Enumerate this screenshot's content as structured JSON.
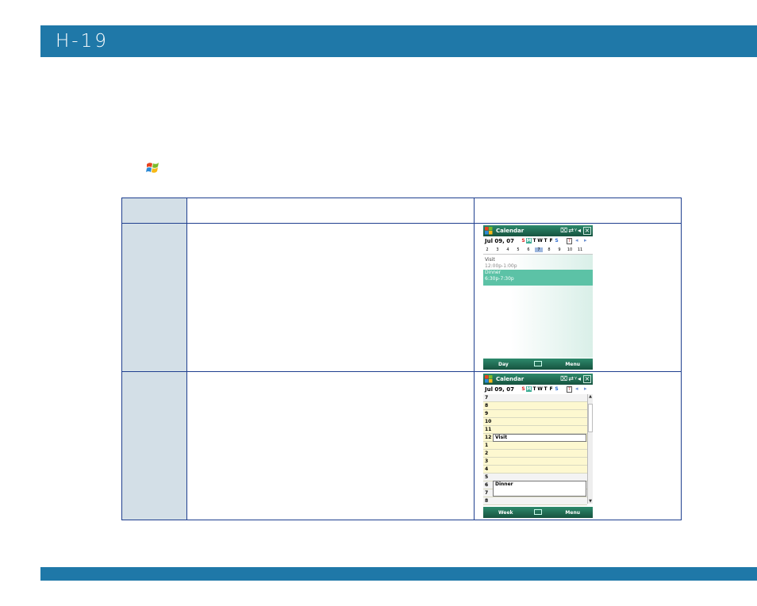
{
  "header": {
    "page_number": "H-19"
  },
  "icons": {
    "start": "windows-start-icon"
  },
  "screen1": {
    "title": "Calendar",
    "date": "Jul 09, 07",
    "weekdays": [
      "S",
      "M",
      "T",
      "W",
      "T",
      "F",
      "S"
    ],
    "week_numbers": [
      "2",
      "3",
      "4",
      "5",
      "6",
      "7",
      "8",
      "9",
      "10",
      "11"
    ],
    "appointments": [
      {
        "name": "Visit",
        "time": "12:00p-1:00p"
      },
      {
        "name": "Dinner",
        "time": "6:30p-7:30p"
      }
    ],
    "left_softkey": "Day",
    "right_softkey": "Menu"
  },
  "screen2": {
    "title": "Calendar",
    "date": "Jul 09, 07",
    "weekdays": [
      "S",
      "M",
      "T",
      "W",
      "T",
      "F",
      "S"
    ],
    "hours": [
      "7",
      "8",
      "9",
      "10",
      "11",
      "12",
      "1",
      "2",
      "3",
      "4",
      "5",
      "6",
      "7",
      "8"
    ],
    "appointments": [
      {
        "name": "Visit"
      },
      {
        "name": "Dinner"
      }
    ],
    "left_softkey": "Week",
    "right_softkey": "Menu"
  },
  "colors": {
    "header_blue": "#1f78a8",
    "table_border": "#1f3f8f",
    "accent_green": "#5cc2a6"
  }
}
